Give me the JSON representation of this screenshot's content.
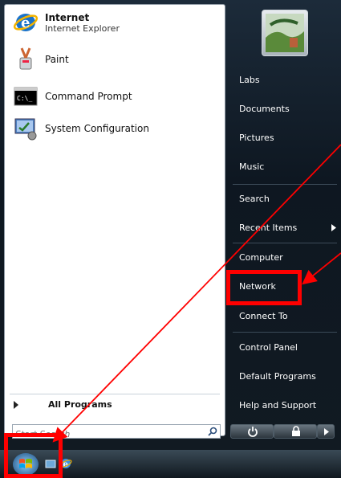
{
  "pinned": [
    {
      "title": "Internet",
      "subtitle": "Internet Explorer",
      "icon": "internet-explorer-icon"
    },
    {
      "title": "Paint",
      "icon": "paint-icon"
    },
    {
      "title": "Command Prompt",
      "icon": "command-prompt-icon"
    },
    {
      "title": "System Configuration",
      "icon": "system-configuration-icon"
    }
  ],
  "all_programs": "All Programs",
  "search": {
    "placeholder": "Start Search"
  },
  "right_items": [
    "Labs",
    "Documents",
    "Pictures",
    "Music",
    "Search",
    "Recent Items",
    "Computer",
    "Network",
    "Connect To",
    "Control Panel",
    "Default Programs",
    "Help and Support"
  ],
  "annotation_color": "#ff0000"
}
